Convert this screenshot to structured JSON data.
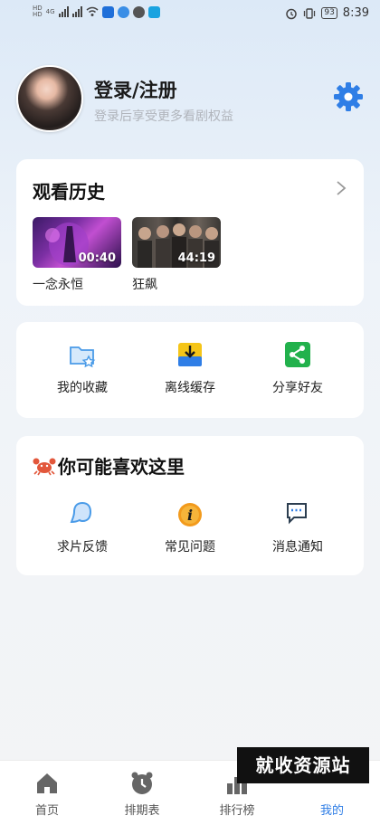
{
  "status_bar": {
    "time": "8:39",
    "battery": "93",
    "network": "4G"
  },
  "profile": {
    "title": "登录/注册",
    "subtitle": "登录后享受更多看剧权益"
  },
  "history": {
    "title": "观看历史",
    "items": [
      {
        "label": "一念永恒",
        "duration": "00:40"
      },
      {
        "label": "狂飙",
        "duration": "44:19"
      }
    ]
  },
  "actions": [
    {
      "label": "我的收藏",
      "icon": "folder-star-icon"
    },
    {
      "label": "离线缓存",
      "icon": "download-icon"
    },
    {
      "label": "分享好友",
      "icon": "share-icon"
    }
  ],
  "tips": {
    "title": "你可能喜欢这里",
    "items": [
      {
        "label": "求片反馈",
        "icon": "feedback-icon"
      },
      {
        "label": "常见问题",
        "icon": "faq-icon"
      },
      {
        "label": "消息通知",
        "icon": "message-icon"
      }
    ]
  },
  "watermark": "就收资源站",
  "tabbar": {
    "items": [
      {
        "label": "首页",
        "icon": "home-icon"
      },
      {
        "label": "排期表",
        "icon": "schedule-icon"
      },
      {
        "label": "排行榜",
        "icon": "ranking-icon"
      },
      {
        "label": "我的",
        "icon": "profile-icon"
      }
    ],
    "active_index": 3
  },
  "colors": {
    "accent": "#2f7ee6",
    "share_green": "#22b14c",
    "download_yellow": "#f5c518",
    "faq_orange": "#f29a1c"
  }
}
